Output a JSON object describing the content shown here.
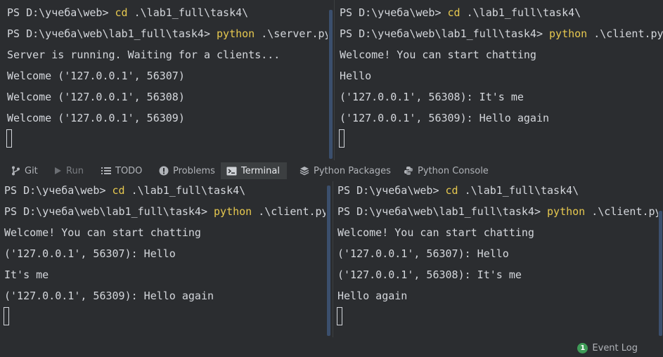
{
  "panes": [
    {
      "name": "server-terminal",
      "lines": [
        {
          "prompt": "PS D:\\учеба\\web> ",
          "cmd": "cd",
          "rest": " .\\lab1_full\\task4\\"
        },
        {
          "prompt": "PS D:\\учеба\\web\\lab1_full\\task4> ",
          "cmd": "python",
          "rest": " .\\server.py"
        },
        {
          "prompt": "",
          "cmd": "",
          "rest": "Server is running. Waiting for a clients..."
        },
        {
          "prompt": "",
          "cmd": "",
          "rest": "Welcome ('127.0.0.1', 56307)"
        },
        {
          "prompt": "",
          "cmd": "",
          "rest": "Welcome ('127.0.0.1', 56308)"
        },
        {
          "prompt": "",
          "cmd": "",
          "rest": "Welcome ('127.0.0.1', 56309)"
        }
      ]
    },
    {
      "name": "client-terminal-top-right",
      "lines": [
        {
          "prompt": "PS D:\\учеба\\web> ",
          "cmd": "cd",
          "rest": " .\\lab1_full\\task4\\"
        },
        {
          "prompt": "PS D:\\учеба\\web\\lab1_full\\task4> ",
          "cmd": "python",
          "rest": " .\\client.py"
        },
        {
          "prompt": "",
          "cmd": "",
          "rest": "Welcome! You can start chatting"
        },
        {
          "prompt": "",
          "cmd": "",
          "rest": "Hello"
        },
        {
          "prompt": "",
          "cmd": "",
          "rest": "('127.0.0.1', 56308): It's me"
        },
        {
          "prompt": "",
          "cmd": "",
          "rest": "('127.0.0.1', 56309): Hello again"
        }
      ]
    },
    {
      "name": "client-terminal-bottom-left",
      "lines": [
        {
          "prompt": "PS D:\\учеба\\web> ",
          "cmd": "cd",
          "rest": " .\\lab1_full\\task4\\"
        },
        {
          "prompt": "PS D:\\учеба\\web\\lab1_full\\task4> ",
          "cmd": "python",
          "rest": " .\\client.py"
        },
        {
          "prompt": "",
          "cmd": "",
          "rest": "Welcome! You can start chatting"
        },
        {
          "prompt": "",
          "cmd": "",
          "rest": "('127.0.0.1', 56307): Hello"
        },
        {
          "prompt": "",
          "cmd": "",
          "rest": "It's me"
        },
        {
          "prompt": "",
          "cmd": "",
          "rest": "('127.0.0.1', 56309): Hello again"
        }
      ]
    },
    {
      "name": "client-terminal-bottom-right",
      "lines": [
        {
          "prompt": "PS D:\\учеба\\web> ",
          "cmd": "cd",
          "rest": " .\\lab1_full\\task4\\"
        },
        {
          "prompt": "PS D:\\учеба\\web\\lab1_full\\task4> ",
          "cmd": "python",
          "rest": " .\\client.py"
        },
        {
          "prompt": "",
          "cmd": "",
          "rest": "Welcome! You can start chatting"
        },
        {
          "prompt": "",
          "cmd": "",
          "rest": "('127.0.0.1', 56307): Hello"
        },
        {
          "prompt": "",
          "cmd": "",
          "rest": "('127.0.0.1', 56308): It's me"
        },
        {
          "prompt": "",
          "cmd": "",
          "rest": "Hello again"
        }
      ]
    }
  ],
  "toolbar": {
    "tabs": [
      {
        "label": "Git",
        "icon": "git-branch-icon"
      },
      {
        "label": "Run",
        "icon": "run-icon"
      },
      {
        "label": "TODO",
        "icon": "list-icon"
      },
      {
        "label": "Problems",
        "icon": "problems-icon"
      },
      {
        "label": "Terminal",
        "icon": "terminal-icon"
      },
      {
        "label": "Python Packages",
        "icon": "packages-icon"
      },
      {
        "label": "Python Console",
        "icon": "python-icon"
      }
    ],
    "active_tab": "Terminal"
  },
  "status": {
    "event_log_label": "Event Log",
    "event_log_count": "1"
  },
  "colors": {
    "background": "#2b2d30",
    "text": "#d4d7dc",
    "command_highlight": "#e6c84f",
    "event_badge": "#3f9b57"
  }
}
